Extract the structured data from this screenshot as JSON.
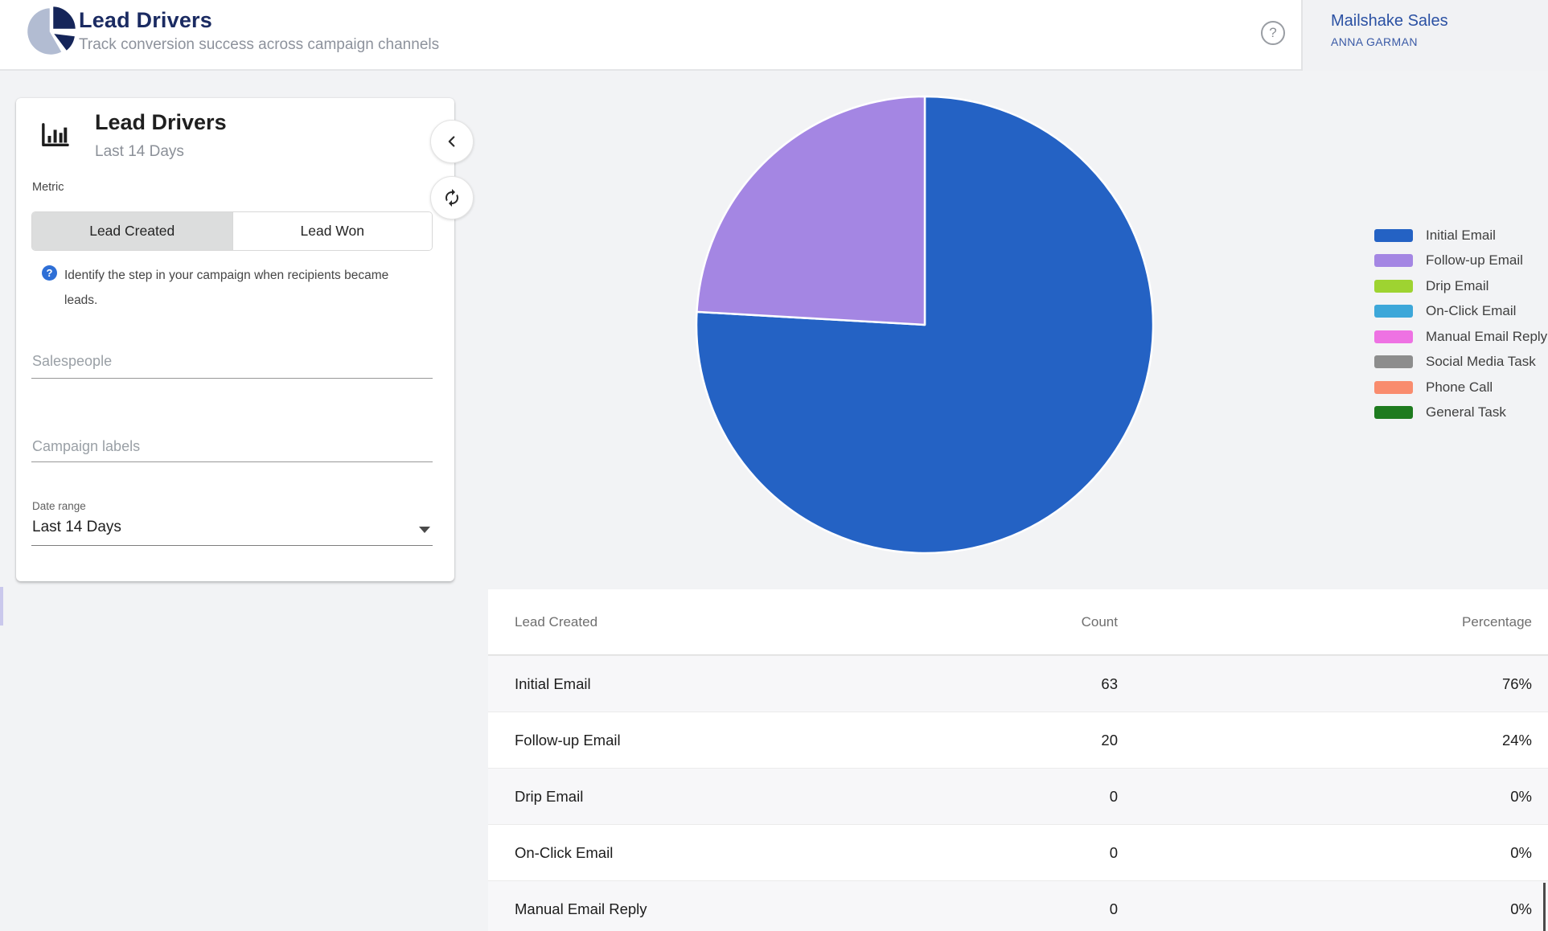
{
  "header": {
    "title": "Lead Drivers",
    "subtitle": "Track conversion success across campaign channels",
    "help_icon": "?",
    "account": {
      "org": "Mailshake Sales",
      "user": "ANNA GARMAN"
    }
  },
  "panel": {
    "title": "Lead Drivers",
    "subtitle": "Last 14 Days",
    "metric_label": "Metric",
    "metric_options": [
      {
        "label": "Lead Created",
        "selected": true
      },
      {
        "label": "Lead Won",
        "selected": false
      }
    ],
    "info_text": "Identify the step in your campaign when recipients became leads.",
    "fields": {
      "salespeople_placeholder": "Salespeople",
      "campaign_labels_placeholder": "Campaign labels",
      "date_range_label": "Date range",
      "date_range_value": "Last 14 Days"
    }
  },
  "chart_data": {
    "type": "pie",
    "title": "",
    "categories": [
      "Initial Email",
      "Follow-up Email",
      "Drip Email",
      "On-Click Email",
      "Manual Email Reply",
      "Social Media Task",
      "Phone Call",
      "General Task"
    ],
    "values": [
      63,
      20,
      0,
      0,
      0,
      0,
      0,
      0
    ],
    "percentages": [
      "76%",
      "24%",
      "0%",
      "0%",
      "0%",
      "0%",
      "0%",
      "0%"
    ],
    "colors": [
      "#2462c4",
      "#a486e3",
      "#9ed331",
      "#3da7d9",
      "#ee72e3",
      "#8d8d8d",
      "#f98c6e",
      "#1e7b1f"
    ],
    "legend_position": "right",
    "start_angle_deg": 0,
    "direction": "clockwise"
  },
  "table": {
    "columns": [
      "Lead Created",
      "Count",
      "Percentage"
    ],
    "rows": [
      {
        "label": "Initial Email",
        "count": 63,
        "percentage": "76%"
      },
      {
        "label": "Follow-up Email",
        "count": 20,
        "percentage": "24%"
      },
      {
        "label": "Drip Email",
        "count": 0,
        "percentage": "0%"
      },
      {
        "label": "On-Click Email",
        "count": 0,
        "percentage": "0%"
      },
      {
        "label": "Manual Email Reply",
        "count": 0,
        "percentage": "0%"
      }
    ]
  }
}
